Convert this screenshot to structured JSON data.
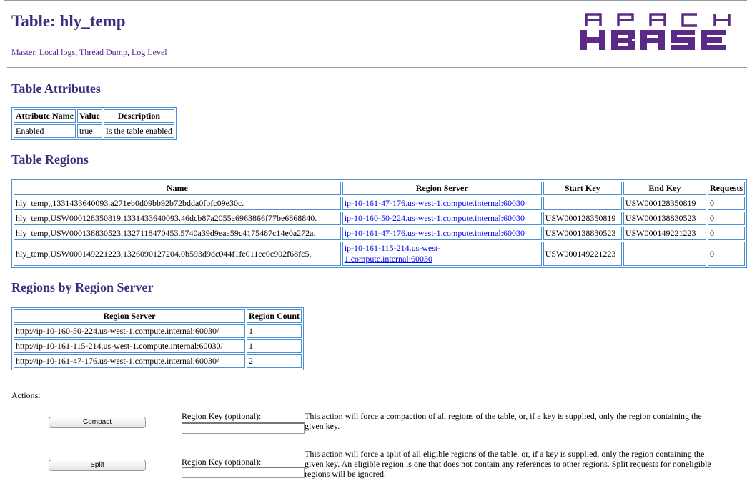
{
  "page": {
    "title": "Table: hly_temp"
  },
  "nav_links": [
    "Master",
    "Local logs",
    "Thread Dump",
    "Log Level"
  ],
  "logo": {
    "top": "A P A C H E",
    "bottom": "HBASE",
    "color": "#5a2a86"
  },
  "attributes": {
    "heading": "Table Attributes",
    "headers": [
      "Attribute Name",
      "Value",
      "Description"
    ],
    "rows": [
      [
        "Enabled",
        "true",
        "Is the table enabled"
      ]
    ]
  },
  "regions": {
    "heading": "Table Regions",
    "headers": [
      "Name",
      "Region Server",
      "Start Key",
      "End Key",
      "Requests"
    ],
    "rows": [
      [
        "hly_temp,,1331433640093.a271eb0d09bb92b72bdda0fbfc09e30c.",
        "ip-10-161-47-176.us-west-1.compute.internal:60030",
        "",
        "USW000128350819",
        "0"
      ],
      [
        "hly_temp,USW000128350819,1331433640093.46dcb87a2055a6963866f77be6868840.",
        "ip-10-160-50-224.us-west-1.compute.internal:60030",
        "USW000128350819",
        "USW000138830523",
        "0"
      ],
      [
        "hly_temp,USW000138830523,1327118470453.5740a39d9eaa59c4175487c14e0a272a.",
        "ip-10-161-47-176.us-west-1.compute.internal:60030",
        "USW000138830523",
        "USW000149221223",
        "0"
      ],
      [
        "hly_temp,USW000149221223,1326090127204.0b593d9dc044f1fe011ec0c902f68fc5.",
        "ip-10-161-115-214.us-west-1.compute.internal:60030",
        "USW000149221223",
        "",
        "0"
      ]
    ]
  },
  "by_server": {
    "heading": "Regions by Region Server",
    "headers": [
      "Region Server",
      "Region Count"
    ],
    "rows": [
      [
        "http://ip-10-160-50-224.us-west-1.compute.internal:60030/",
        "1"
      ],
      [
        "http://ip-10-161-115-214.us-west-1.compute.internal:60030/",
        "1"
      ],
      [
        "http://ip-10-161-47-176.us-west-1.compute.internal:60030/",
        "2"
      ]
    ]
  },
  "actions": {
    "label": "Actions:",
    "compact": {
      "button": "Compact",
      "key_label": "Region Key (optional):",
      "key_value": "",
      "description": "This action will force a compaction of all regions of the table, or, if a key is supplied, only the region containing the given key."
    },
    "split": {
      "button": "Split",
      "key_label": "Region Key (optional):",
      "key_value": "",
      "description": "This action will force a split of all eligible regions of the table, or, if a key is supplied, only the region containing the given key. An eligible region is one that does not contain any references to other regions. Split requests for noneligible regions will be ignored."
    }
  }
}
